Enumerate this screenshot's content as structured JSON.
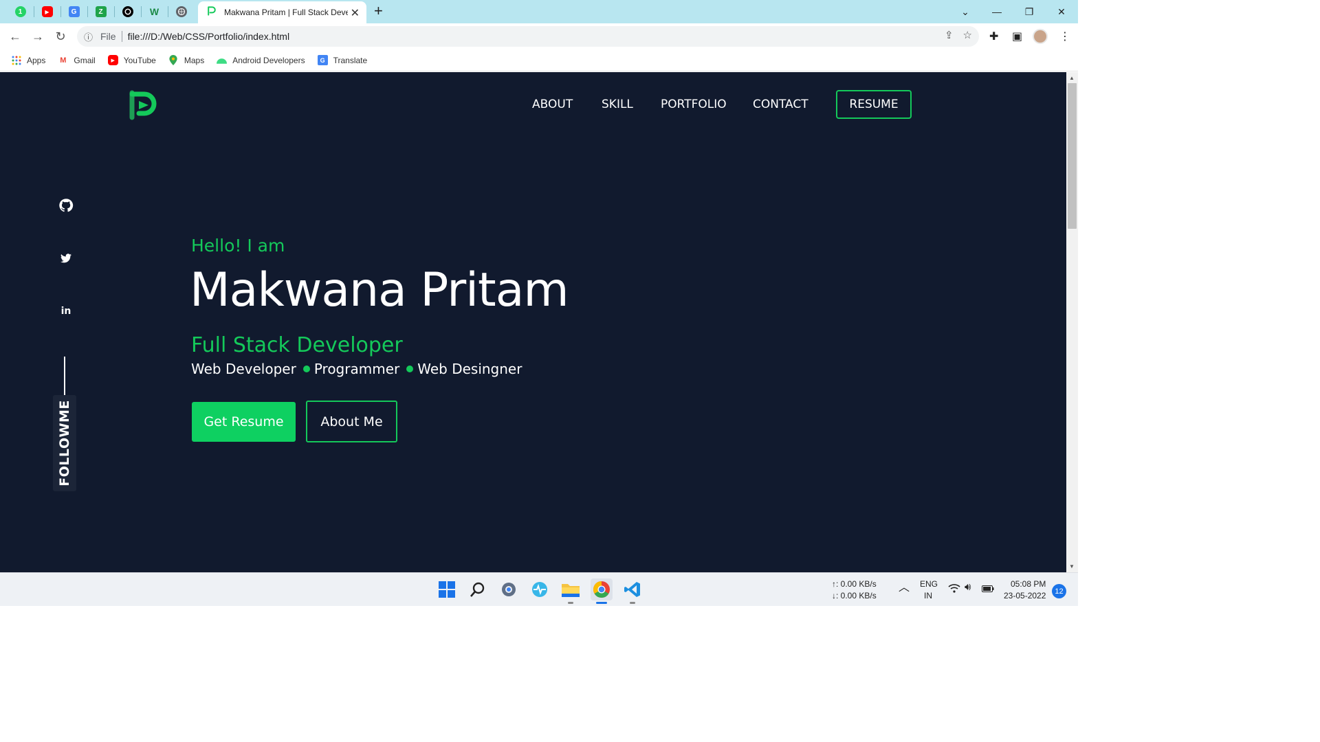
{
  "browser": {
    "pinned_tabs": [
      {
        "icon": "whatsapp-icon",
        "color": "#25d366",
        "glyph": "1"
      },
      {
        "icon": "youtube-icon",
        "color": "#ff0000",
        "glyph": "▶"
      },
      {
        "icon": "translate-icon",
        "color": "#4285f4",
        "glyph": "G"
      },
      {
        "icon": "green-shield-icon",
        "color": "#1fa34a",
        "glyph": "Z"
      },
      {
        "icon": "github-icon",
        "color": "#000000",
        "glyph": "●"
      },
      {
        "icon": "wordpress-w-icon",
        "color": "#1c8a47",
        "glyph": "W"
      },
      {
        "icon": "globe-icon",
        "color": "#5f6368",
        "glyph": "●"
      }
    ],
    "active_tab_title": "Makwana Pritam | Full Stack Developer",
    "address": {
      "scheme": "File",
      "url": "file:///D:/Web/CSS/Portfolio/index.html"
    },
    "bookmarks": [
      {
        "label": "Apps",
        "icon": "apps-grid-icon",
        "color": "#4285f4"
      },
      {
        "label": "Gmail",
        "icon": "gmail-icon",
        "color": "#ea4335"
      },
      {
        "label": "YouTube",
        "icon": "youtube-icon",
        "color": "#ff0000"
      },
      {
        "label": "Maps",
        "icon": "maps-pin-icon",
        "color": "#34a853"
      },
      {
        "label": "Android Developers",
        "icon": "android-icon",
        "color": "#3ddc84"
      },
      {
        "label": "Translate",
        "icon": "translate-icon",
        "color": "#4285f4"
      }
    ]
  },
  "site": {
    "nav": [
      "ABOUT",
      "SKILL",
      "PORTFOLIO",
      "CONTACT"
    ],
    "resume_label": "RESUME",
    "hello": "Hello! I am",
    "name": "Makwana Pritam",
    "role": "Full Stack Developer",
    "tags": [
      "Web Developer",
      "Programmer",
      "Web Desingner"
    ],
    "primary_button": "Get Resume",
    "secondary_button": "About Me",
    "follow_label": "FOLLOWME",
    "social": [
      "github-icon",
      "twitter-icon",
      "linkedin-icon"
    ],
    "accent_color": "#14c95a",
    "background_color": "#111a2e"
  },
  "taskbar": {
    "apps": [
      "windows-start-icon",
      "search-icon",
      "settings-icon",
      "activity-icon",
      "file-explorer-icon",
      "chrome-icon",
      "vscode-icon"
    ],
    "upload_speed": "↑: 0.00 KB/s",
    "download_speed": "↓: 0.00 KB/s",
    "language_top": "ENG",
    "language_bottom": "IN",
    "time": "05:08 PM",
    "date": "23-05-2022",
    "notifications": "12"
  }
}
